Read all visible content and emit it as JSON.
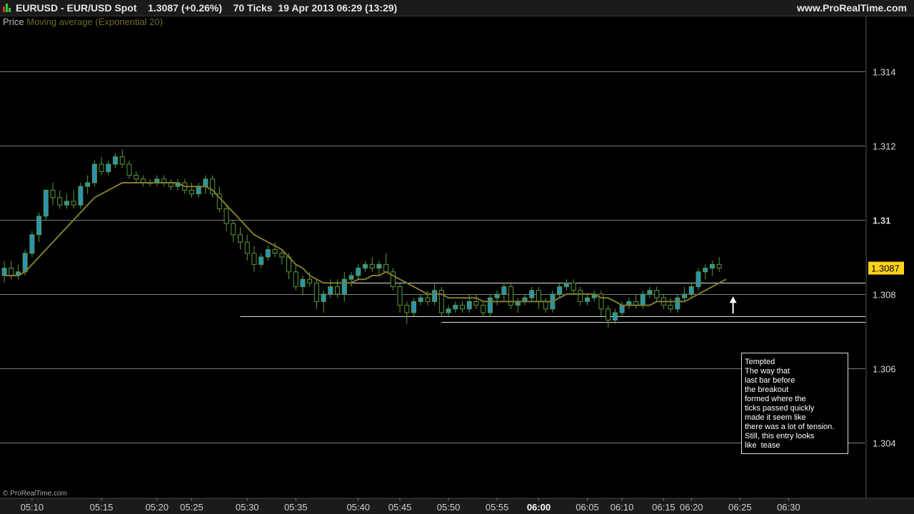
{
  "header": {
    "title": "EURUSD - EUR/USD Spot    1.3087 (+0.26%)    70 Ticks  19 Apr 2013 06:29 (13:29)",
    "site": "www.ProRealTime.com",
    "icon": "bar-chart-icon"
  },
  "legend": {
    "price_label": "Price",
    "ma_label": "Moving average (Exponential 20)"
  },
  "watermark": "© ProRealTime.com",
  "note_lines": [
    "Tempted",
    "The way that",
    "last bar before",
    "the breakout",
    "formed where the",
    "ticks passed quickly",
    "made it seem like",
    "there was a lot of tension.",
    "Still, this entry looks",
    "like  tease"
  ],
  "colors": {
    "background": "#000000",
    "candle_up": "#2a93b8",
    "candle_down": "#000000",
    "wick_up": "#5a9a3c",
    "wick_down": "#5a9a3c",
    "ma_line": "#837d2a",
    "grid": "#7a7a7a",
    "price_tag_bg": "#ffd21a",
    "arrow": "#ffffff"
  },
  "chart_data": {
    "type": "candlestick",
    "ylim": [
      1.3025,
      1.3155
    ],
    "yticks": [
      {
        "value": 1.304,
        "label": "1.304"
      },
      {
        "value": 1.306,
        "label": "1.306"
      },
      {
        "value": 1.308,
        "label": "1.308"
      },
      {
        "value": 1.31,
        "label": "1.31"
      },
      {
        "value": 1.312,
        "label": "1.312"
      },
      {
        "value": 1.314,
        "label": "1.314"
      }
    ],
    "bold_ytick": "1.31",
    "last_price": 1.3087,
    "last_price_label": "1.3087",
    "xticks": [
      {
        "bar": 4,
        "label": "05:10"
      },
      {
        "bar": 14,
        "label": "05:15"
      },
      {
        "bar": 22,
        "label": "05:20"
      },
      {
        "bar": 27,
        "label": "05:25"
      },
      {
        "bar": 35,
        "label": "05:30"
      },
      {
        "bar": 42,
        "label": "05:35"
      },
      {
        "bar": 51,
        "label": "05:40"
      },
      {
        "bar": 57,
        "label": "05:45"
      },
      {
        "bar": 64,
        "label": "05:50"
      },
      {
        "bar": 71,
        "label": "05:55"
      },
      {
        "bar": 77,
        "label": "06:00",
        "bold": true
      },
      {
        "bar": 84,
        "label": "06:05"
      },
      {
        "bar": 89,
        "label": "06:10"
      },
      {
        "bar": 95,
        "label": "06:15"
      },
      {
        "bar": 99,
        "label": "06:20"
      },
      {
        "bar": 106,
        "label": "06:25"
      },
      {
        "bar": 113,
        "label": "06:30"
      }
    ],
    "level_lines": [
      {
        "price": 1.3083,
        "from_bar": 48
      },
      {
        "price": 1.3074,
        "from_bar": 34
      },
      {
        "price": 1.30725,
        "from_bar": 63
      }
    ],
    "arrow": {
      "bar": 105,
      "price": 1.3079
    },
    "series": [
      {
        "name": "Price",
        "ohlc": [
          [
            1.3085,
            1.3089,
            1.3083,
            1.3087
          ],
          [
            1.3087,
            1.3089,
            1.3084,
            1.3085
          ],
          [
            1.3085,
            1.3088,
            1.3084,
            1.3086
          ],
          [
            1.3086,
            1.3092,
            1.3085,
            1.3091
          ],
          [
            1.3091,
            1.3097,
            1.309,
            1.3096
          ],
          [
            1.3096,
            1.3102,
            1.3094,
            1.3101
          ],
          [
            1.3101,
            1.3106,
            1.31,
            1.3108
          ],
          [
            1.3108,
            1.311,
            1.3104,
            1.3106
          ],
          [
            1.3106,
            1.3108,
            1.3103,
            1.3104
          ],
          [
            1.3104,
            1.3107,
            1.3103,
            1.3105
          ],
          [
            1.3105,
            1.3108,
            1.3103,
            1.3104
          ],
          [
            1.3104,
            1.311,
            1.3103,
            1.3109
          ],
          [
            1.3109,
            1.3112,
            1.3107,
            1.311
          ],
          [
            1.311,
            1.3116,
            1.3109,
            1.3115
          ],
          [
            1.3115,
            1.3117,
            1.3112,
            1.3113
          ],
          [
            1.3113,
            1.3116,
            1.3112,
            1.3115
          ],
          [
            1.3115,
            1.3118,
            1.3114,
            1.3117
          ],
          [
            1.3117,
            1.3119,
            1.3114,
            1.3115
          ],
          [
            1.3115,
            1.3116,
            1.3111,
            1.3112
          ],
          [
            1.3112,
            1.3113,
            1.311,
            1.3111
          ],
          [
            1.3111,
            1.3112,
            1.3109,
            1.311
          ],
          [
            1.311,
            1.3111,
            1.3109,
            1.311
          ],
          [
            1.311,
            1.3112,
            1.3109,
            1.3111
          ],
          [
            1.3111,
            1.3112,
            1.3109,
            1.311
          ],
          [
            1.311,
            1.3111,
            1.3108,
            1.3109
          ],
          [
            1.3109,
            1.3111,
            1.3108,
            1.311
          ],
          [
            1.311,
            1.3111,
            1.3107,
            1.3108
          ],
          [
            1.3108,
            1.311,
            1.3106,
            1.3107
          ],
          [
            1.3107,
            1.311,
            1.3106,
            1.3109
          ],
          [
            1.3109,
            1.3112,
            1.3107,
            1.3111
          ],
          [
            1.3111,
            1.3112,
            1.3106,
            1.3107
          ],
          [
            1.3107,
            1.3109,
            1.3102,
            1.3103
          ],
          [
            1.3103,
            1.3104,
            1.3097,
            1.3099
          ],
          [
            1.3099,
            1.31,
            1.3094,
            1.3096
          ],
          [
            1.3096,
            1.3098,
            1.3092,
            1.3094
          ],
          [
            1.3094,
            1.3096,
            1.3089,
            1.3091
          ],
          [
            1.3091,
            1.3093,
            1.3086,
            1.3088
          ],
          [
            1.3088,
            1.3091,
            1.3087,
            1.309
          ],
          [
            1.309,
            1.3093,
            1.3089,
            1.3092
          ],
          [
            1.3092,
            1.3094,
            1.309,
            1.3091
          ],
          [
            1.3091,
            1.3092,
            1.3088,
            1.309
          ],
          [
            1.309,
            1.3091,
            1.3084,
            1.3086
          ],
          [
            1.3086,
            1.3088,
            1.3081,
            1.3082
          ],
          [
            1.3082,
            1.3085,
            1.308,
            1.3084
          ],
          [
            1.3084,
            1.3086,
            1.3082,
            1.3083
          ],
          [
            1.3083,
            1.3084,
            1.3076,
            1.3078
          ],
          [
            1.3078,
            1.3081,
            1.3075,
            1.308
          ],
          [
            1.308,
            1.3084,
            1.3079,
            1.3082
          ],
          [
            1.3082,
            1.3084,
            1.3079,
            1.308
          ],
          [
            1.308,
            1.3086,
            1.3078,
            1.3084
          ],
          [
            1.3084,
            1.3086,
            1.3082,
            1.3085
          ],
          [
            1.3085,
            1.3088,
            1.3084,
            1.3087
          ],
          [
            1.3087,
            1.3089,
            1.3086,
            1.3088
          ],
          [
            1.3088,
            1.309,
            1.3086,
            1.3087
          ],
          [
            1.3087,
            1.3089,
            1.3085,
            1.3088
          ],
          [
            1.3088,
            1.3091,
            1.3086,
            1.3086
          ],
          [
            1.3086,
            1.3087,
            1.3081,
            1.3082
          ],
          [
            1.3082,
            1.3083,
            1.3075,
            1.3077
          ],
          [
            1.3077,
            1.3078,
            1.3072,
            1.3075
          ],
          [
            1.3075,
            1.3079,
            1.3074,
            1.3078
          ],
          [
            1.3078,
            1.308,
            1.3077,
            1.3079
          ],
          [
            1.3079,
            1.3081,
            1.3077,
            1.3078
          ],
          [
            1.3078,
            1.3083,
            1.3077,
            1.3081
          ],
          [
            1.3081,
            1.3082,
            1.3074,
            1.3075
          ],
          [
            1.3075,
            1.3077,
            1.3074,
            1.3076
          ],
          [
            1.3076,
            1.3078,
            1.3075,
            1.3077
          ],
          [
            1.3077,
            1.3078,
            1.3075,
            1.3076
          ],
          [
            1.3076,
            1.308,
            1.3075,
            1.3078
          ],
          [
            1.3078,
            1.308,
            1.3076,
            1.3077
          ],
          [
            1.3077,
            1.3078,
            1.3074,
            1.3075
          ],
          [
            1.3075,
            1.308,
            1.3074,
            1.3079
          ],
          [
            1.3079,
            1.3081,
            1.3077,
            1.308
          ],
          [
            1.308,
            1.3083,
            1.3078,
            1.3082
          ],
          [
            1.3082,
            1.3083,
            1.3076,
            1.3077
          ],
          [
            1.3077,
            1.3079,
            1.3075,
            1.3078
          ],
          [
            1.3078,
            1.308,
            1.3077,
            1.3079
          ],
          [
            1.3079,
            1.3082,
            1.3078,
            1.3081
          ],
          [
            1.3081,
            1.3082,
            1.3076,
            1.3078
          ],
          [
            1.3078,
            1.3079,
            1.3075,
            1.3076
          ],
          [
            1.3076,
            1.3081,
            1.3075,
            1.308
          ],
          [
            1.308,
            1.3083,
            1.3079,
            1.3082
          ],
          [
            1.3082,
            1.3084,
            1.3081,
            1.3083
          ],
          [
            1.3083,
            1.3084,
            1.308,
            1.3081
          ],
          [
            1.3081,
            1.3082,
            1.3077,
            1.3078
          ],
          [
            1.3078,
            1.308,
            1.3077,
            1.3079
          ],
          [
            1.3079,
            1.3081,
            1.3078,
            1.308
          ],
          [
            1.308,
            1.3081,
            1.3074,
            1.3076
          ],
          [
            1.3076,
            1.3077,
            1.3071,
            1.3073
          ],
          [
            1.3073,
            1.3076,
            1.3072,
            1.3075
          ],
          [
            1.3075,
            1.3078,
            1.3074,
            1.3077
          ],
          [
            1.3077,
            1.3079,
            1.3076,
            1.3078
          ],
          [
            1.3078,
            1.308,
            1.3076,
            1.3077
          ],
          [
            1.3077,
            1.3081,
            1.3076,
            1.308
          ],
          [
            1.308,
            1.3082,
            1.3079,
            1.3081
          ],
          [
            1.3081,
            1.3082,
            1.3078,
            1.3079
          ],
          [
            1.3079,
            1.308,
            1.3076,
            1.3077
          ],
          [
            1.3077,
            1.3079,
            1.3075,
            1.3076
          ],
          [
            1.3076,
            1.308,
            1.3075,
            1.3079
          ],
          [
            1.3079,
            1.3082,
            1.3078,
            1.308
          ],
          [
            1.308,
            1.3083,
            1.3079,
            1.3082
          ],
          [
            1.3082,
            1.3087,
            1.3081,
            1.3086
          ],
          [
            1.3086,
            1.3088,
            1.3084,
            1.3087
          ],
          [
            1.3087,
            1.3089,
            1.3085,
            1.3088
          ],
          [
            1.3088,
            1.309,
            1.3086,
            1.3087
          ]
        ]
      },
      {
        "name": "Moving average (Exponential 20)",
        "values": [
          1.3085,
          1.3085,
          1.3085,
          1.3086,
          1.3088,
          1.309,
          1.3092,
          1.3094,
          1.3096,
          1.3098,
          1.31,
          1.3102,
          1.3104,
          1.3106,
          1.3107,
          1.3108,
          1.3109,
          1.311,
          1.311,
          1.311,
          1.311,
          1.311,
          1.311,
          1.311,
          1.311,
          1.311,
          1.3109,
          1.3109,
          1.3109,
          1.3109,
          1.3108,
          1.3106,
          1.3104,
          1.3102,
          1.31,
          1.3098,
          1.3096,
          1.3095,
          1.3094,
          1.3093,
          1.3092,
          1.309,
          1.3088,
          1.3087,
          1.3085,
          1.3084,
          1.3083,
          1.3083,
          1.3083,
          1.3083,
          1.3083,
          1.3084,
          1.3084,
          1.3085,
          1.3085,
          1.3086,
          1.3085,
          1.3084,
          1.3083,
          1.3082,
          1.3081,
          1.308,
          1.308,
          1.308,
          1.3079,
          1.3079,
          1.3079,
          1.3079,
          1.3079,
          1.3078,
          1.3078,
          1.3078,
          1.3078,
          1.3078,
          1.3078,
          1.3078,
          1.3078,
          1.3078,
          1.3078,
          1.3078,
          1.3079,
          1.308,
          1.308,
          1.308,
          1.308,
          1.308,
          1.3079,
          1.3079,
          1.3078,
          1.3077,
          1.3077,
          1.3077,
          1.3077,
          1.3077,
          1.3078,
          1.3078,
          1.3078,
          1.3078,
          1.3078,
          1.3079,
          1.308,
          1.3081,
          1.3082,
          1.3083,
          1.3084
        ]
      }
    ]
  }
}
